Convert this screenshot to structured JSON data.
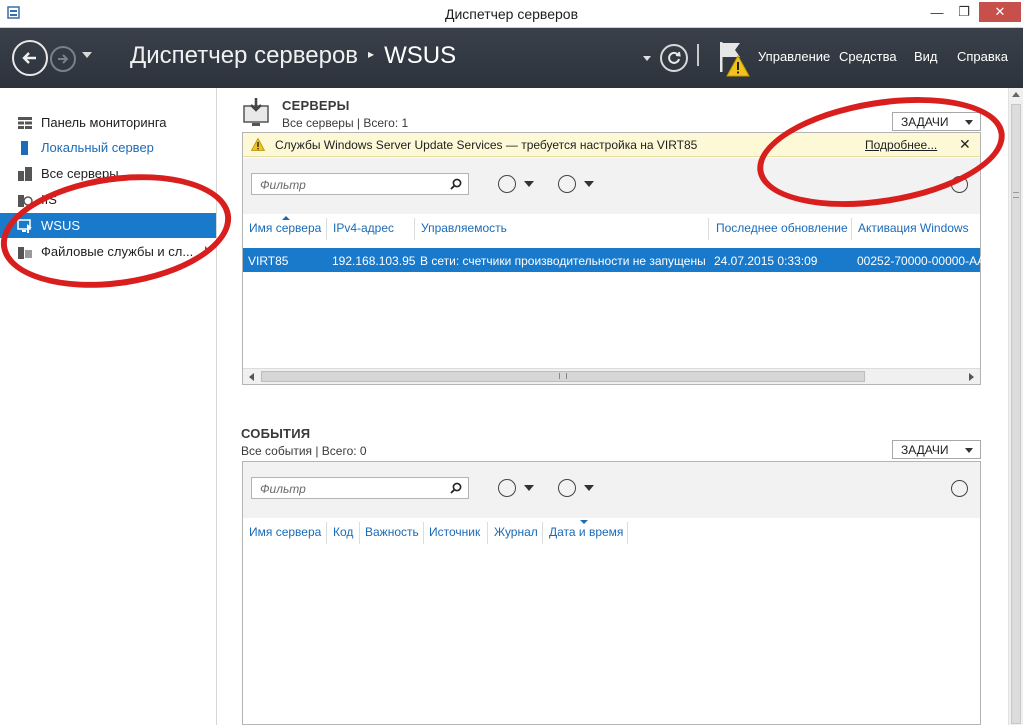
{
  "window": {
    "title": "Диспетчер серверов",
    "minimize": "—",
    "restore": "❐",
    "close": "✕"
  },
  "header": {
    "breadcrumb_root": "Диспетчер серверов",
    "breadcrumb_sep": "▸",
    "breadcrumb_current": "WSUS",
    "menu": [
      "Управление",
      "Средства",
      "Вид",
      "Справка"
    ]
  },
  "sidebar": {
    "items": [
      {
        "label": "Панель мониторинга",
        "icon": "dashboard-icon"
      },
      {
        "label": "Локальный сервер",
        "icon": "local-server-icon"
      },
      {
        "label": "Все серверы",
        "icon": "all-servers-icon"
      },
      {
        "label": "IIS",
        "icon": "iis-icon"
      },
      {
        "label": "WSUS",
        "icon": "wsus-icon"
      },
      {
        "label": "Файловые службы и сл...",
        "icon": "file-services-icon"
      }
    ]
  },
  "servers": {
    "title": "СЕРВЕРЫ",
    "subtitle": "Все серверы | Всего: 1",
    "tasks_label": "ЗАДАЧИ",
    "notice": {
      "message": "Службы Windows Server Update Services — требуется настройка на VIRT85",
      "link": "Подробнее...",
      "close": "✕"
    },
    "filter_placeholder": "Фильтр",
    "columns": [
      "Имя сервера",
      "IPv4-адрес",
      "Управляемость",
      "Последнее обновление",
      "Активация Windows"
    ],
    "rows": [
      [
        "VIRT85",
        "192.168.103.95",
        "В сети: счетчики производительности не запущены",
        "24.07.2015 0:33:09",
        "00252-70000-00000-AA"
      ]
    ]
  },
  "events": {
    "title": "СОБЫТИЯ",
    "subtitle": "Все события | Всего: 0",
    "tasks_label": "ЗАДАЧИ",
    "filter_placeholder": "Фильтр",
    "columns": [
      "Имя сервера",
      "Код",
      "Важность",
      "Источник",
      "Журнал",
      "Дата и время"
    ]
  },
  "colors": {
    "header_bg": "#2d333c",
    "selection": "#1979ca",
    "link": "#1a6bb8",
    "notice_bg": "#fdf9d6",
    "annotation": "#d91e1e"
  }
}
